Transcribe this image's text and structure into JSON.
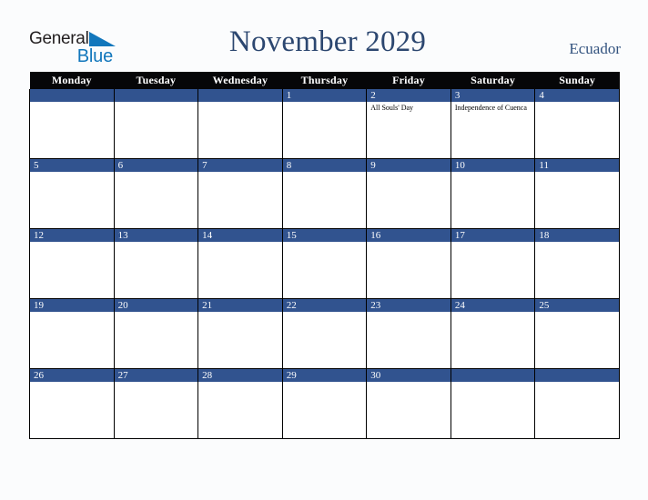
{
  "brand": {
    "name_part1": "General",
    "name_part2": "Blue",
    "triangle_color": "#1277bc",
    "text_color": "#231f20"
  },
  "header": {
    "title": "November 2029",
    "country": "Ecuador",
    "title_color": "#2c4770",
    "country_color": "#33537f"
  },
  "calendar": {
    "accent_color": "#31538f",
    "header_bg": "#060608",
    "weekdays": [
      "Monday",
      "Tuesday",
      "Wednesday",
      "Thursday",
      "Friday",
      "Saturday",
      "Sunday"
    ],
    "weeks": [
      [
        {
          "day": "",
          "events": []
        },
        {
          "day": "",
          "events": []
        },
        {
          "day": "",
          "events": []
        },
        {
          "day": "1",
          "events": []
        },
        {
          "day": "2",
          "events": [
            "All Souls' Day"
          ]
        },
        {
          "day": "3",
          "events": [
            "Independence of Cuenca"
          ]
        },
        {
          "day": "4",
          "events": []
        }
      ],
      [
        {
          "day": "5",
          "events": []
        },
        {
          "day": "6",
          "events": []
        },
        {
          "day": "7",
          "events": []
        },
        {
          "day": "8",
          "events": []
        },
        {
          "day": "9",
          "events": []
        },
        {
          "day": "10",
          "events": []
        },
        {
          "day": "11",
          "events": []
        }
      ],
      [
        {
          "day": "12",
          "events": []
        },
        {
          "day": "13",
          "events": []
        },
        {
          "day": "14",
          "events": []
        },
        {
          "day": "15",
          "events": []
        },
        {
          "day": "16",
          "events": []
        },
        {
          "day": "17",
          "events": []
        },
        {
          "day": "18",
          "events": []
        }
      ],
      [
        {
          "day": "19",
          "events": []
        },
        {
          "day": "20",
          "events": []
        },
        {
          "day": "21",
          "events": []
        },
        {
          "day": "22",
          "events": []
        },
        {
          "day": "23",
          "events": []
        },
        {
          "day": "24",
          "events": []
        },
        {
          "day": "25",
          "events": []
        }
      ],
      [
        {
          "day": "26",
          "events": []
        },
        {
          "day": "27",
          "events": []
        },
        {
          "day": "28",
          "events": []
        },
        {
          "day": "29",
          "events": []
        },
        {
          "day": "30",
          "events": []
        },
        {
          "day": "",
          "events": []
        },
        {
          "day": "",
          "events": []
        }
      ]
    ]
  }
}
